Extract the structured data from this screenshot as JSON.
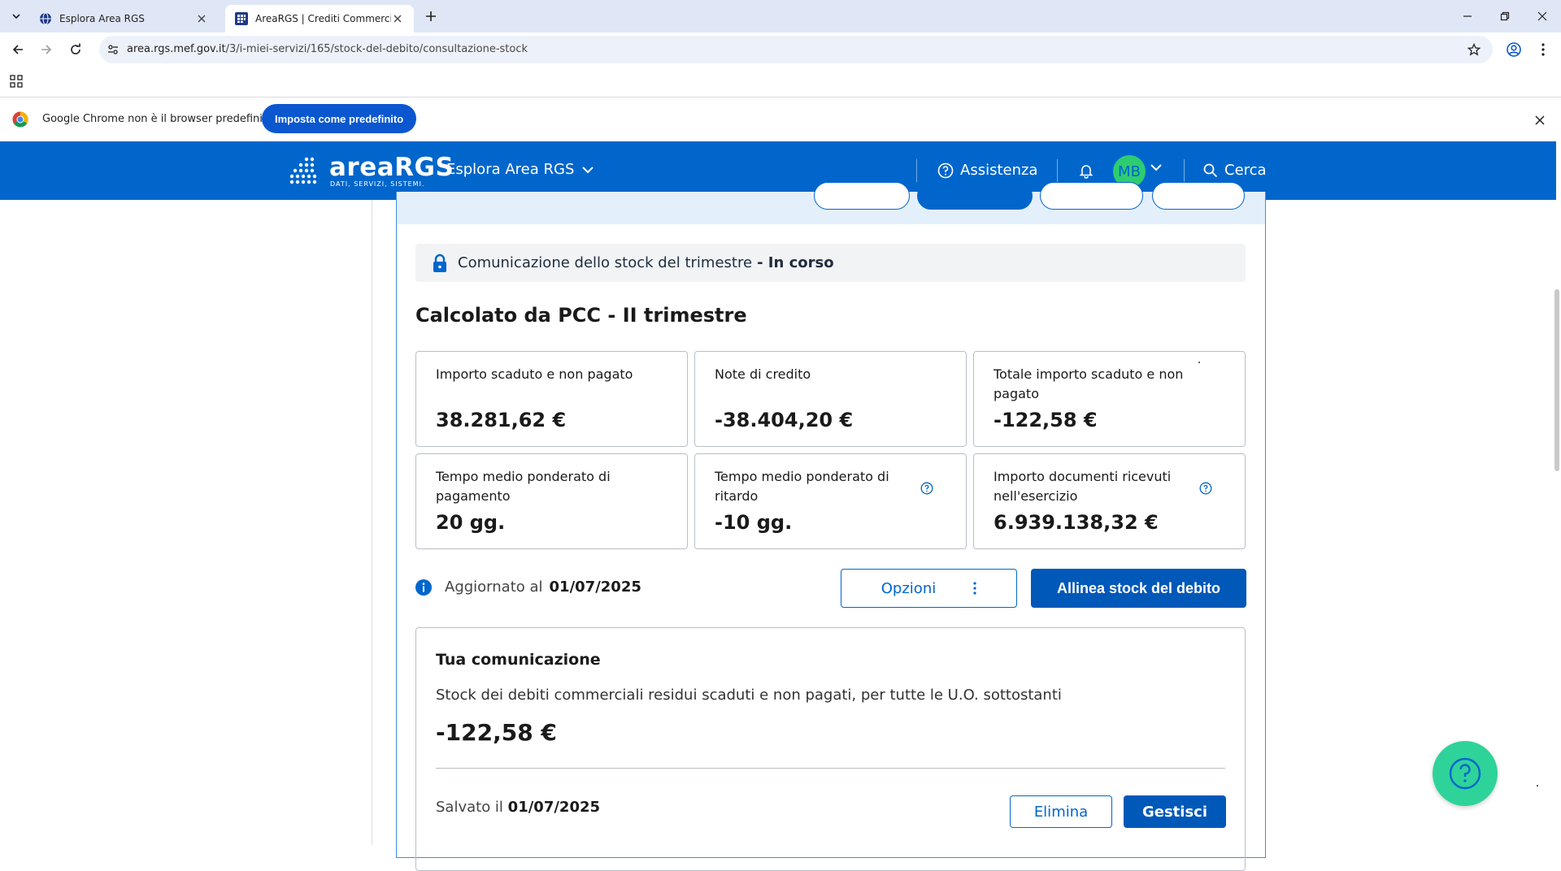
{
  "browser": {
    "tabs": [
      {
        "title": "Esplora Area RGS",
        "active": false
      },
      {
        "title": "AreaRGS | Crediti Commerciali",
        "active": true
      }
    ],
    "url_host": "area.rgs.mef.gov.it",
    "url_path": "/3/i-miei-servizi/165/stock-del-debito/consultazione-stock",
    "infobar": {
      "message": "Google Chrome non è il browser predefinito",
      "button_label": "Imposta come predefinito"
    }
  },
  "header": {
    "logo_word": "areaRGS",
    "logo_sub": "DATI, SERVIZI, SISTEMI.",
    "explore_label": "Esplora Area RGS",
    "assist_label": "Assistenza",
    "avatar_initials": "MB",
    "search_label": "Cerca"
  },
  "status": {
    "text": "Comunicazione dello stock del trimestre",
    "state": "- In corso"
  },
  "section_title": "Calcolato da PCC - II trimestre",
  "kpis": [
    {
      "label": "Importo scaduto e non pagato",
      "value": "38.281,62 €",
      "help": false
    },
    {
      "label": "Note di credito",
      "value": "-38.404,20 €",
      "help": false
    },
    {
      "label": "Totale importo scaduto e non pagato",
      "value": "-122,58 €",
      "help": false
    },
    {
      "label": "Tempo medio ponderato di pagamento",
      "value": "20 gg.",
      "help": false
    },
    {
      "label": "Tempo medio ponderato di ritardo",
      "value": "-10 gg.",
      "help": true
    },
    {
      "label": "Importo documenti ricevuti nell'esercizio",
      "value": "6.939.138,32 €",
      "help": true
    }
  ],
  "updated": {
    "label": "Aggiornato al",
    "date": "01/07/2025"
  },
  "actions": {
    "options_label": "Opzioni",
    "align_label": "Allinea stock del debito"
  },
  "communication": {
    "title": "Tua comunicazione",
    "description": "Stock dei debiti commerciali residui scaduti e non pagati, per tutte le U.O. sottostanti",
    "value": "-122,58 €",
    "saved_label": "Salvato il",
    "saved_date": "01/07/2025",
    "delete_label": "Elimina",
    "manage_label": "Gestisci"
  },
  "colors": {
    "brand_blue": "#0066cc",
    "accent_green": "#2ed39a"
  }
}
